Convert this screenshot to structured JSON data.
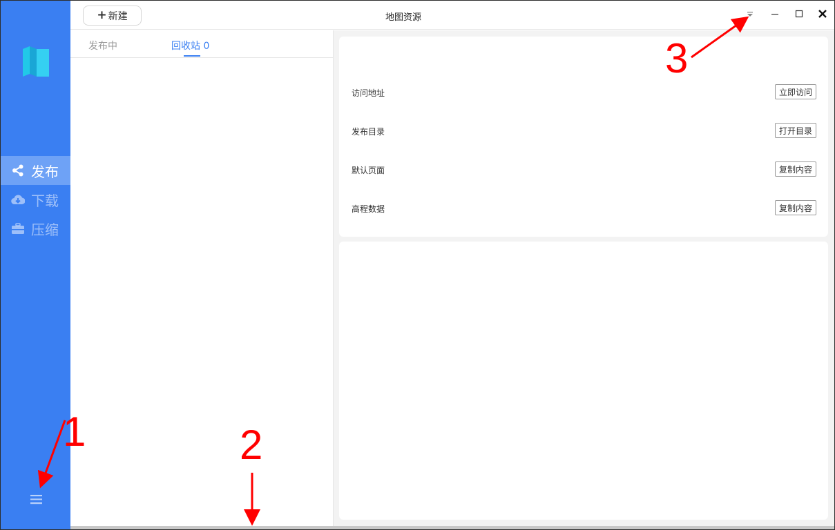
{
  "window": {
    "title": "地图资源"
  },
  "toolbar": {
    "new_label": "新建",
    "new_icon": "plus-icon"
  },
  "sidebar": {
    "items": [
      {
        "label": "发布",
        "icon": "share-icon",
        "active": true
      },
      {
        "label": "下载",
        "icon": "cloud-download-icon",
        "active": false
      },
      {
        "label": "压缩",
        "icon": "briefcase-icon",
        "active": false
      }
    ],
    "menu_icon": "hamburger-menu-icon"
  },
  "tabs": [
    {
      "label": "发布中",
      "active": false
    },
    {
      "label": "回收站 0",
      "active": true
    }
  ],
  "detail": {
    "rows": [
      {
        "label": "访问地址",
        "button": "立即访问"
      },
      {
        "label": "发布目录",
        "button": "打开目录"
      },
      {
        "label": "默认页面",
        "button": "复制内容"
      },
      {
        "label": "高程数据",
        "button": "复制内容"
      }
    ]
  },
  "annotations": [
    "1",
    "2",
    "3"
  ],
  "colors": {
    "accent": "#3a7ff2",
    "annotation": "#ff0000",
    "sidebar_active": "#6ea2f6"
  }
}
